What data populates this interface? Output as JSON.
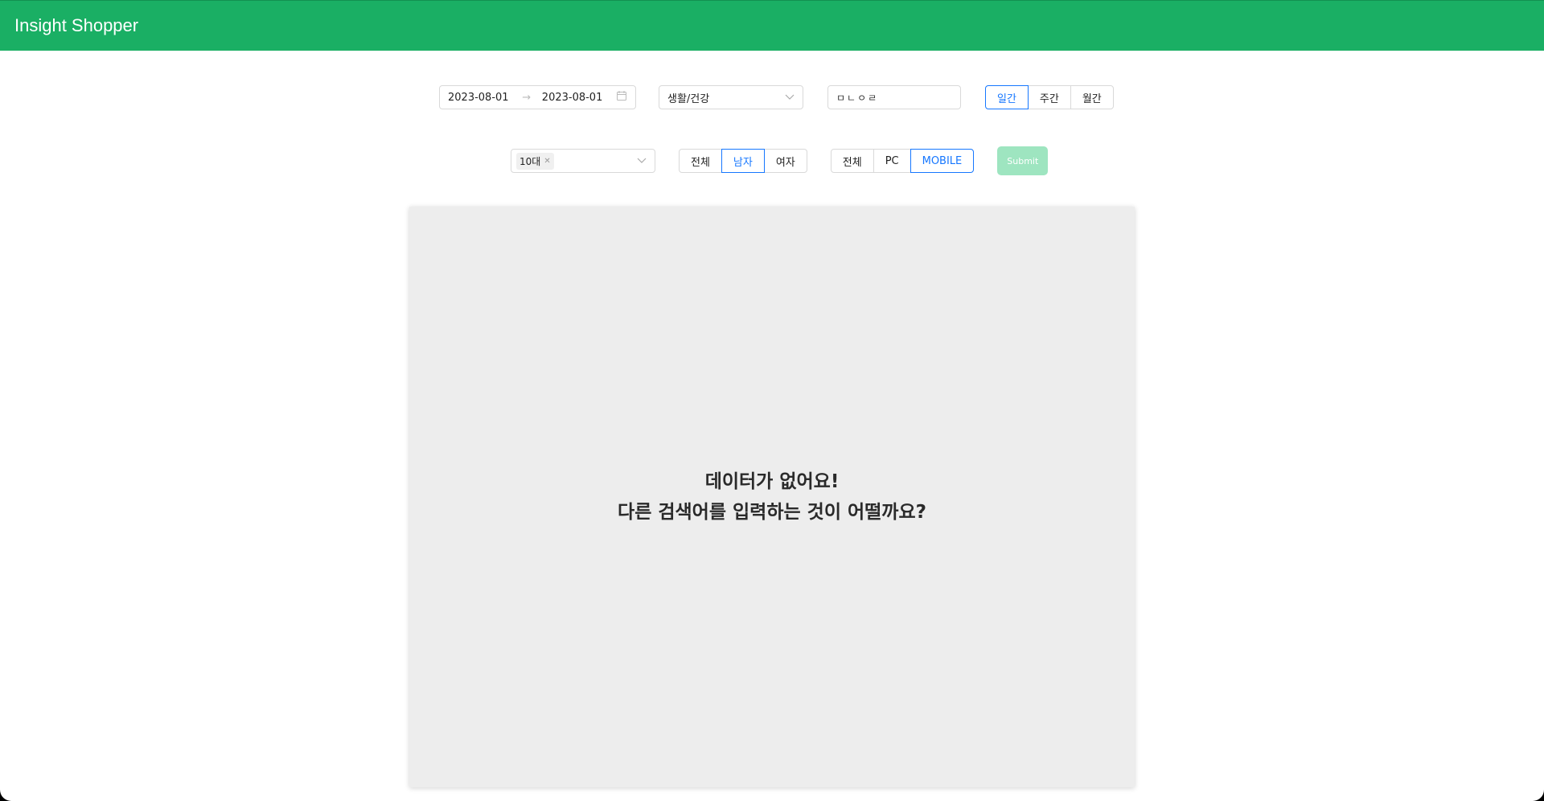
{
  "header": {
    "title": "Insight Shopper"
  },
  "filters": {
    "date_range": {
      "start": "2023-08-01",
      "end": "2023-08-01",
      "separator": "→"
    },
    "category": {
      "selected": "생활/건강"
    },
    "keyword": {
      "value": "ㅁㄴㅇㄹ"
    },
    "period": {
      "options": [
        "일간",
        "주간",
        "월간"
      ],
      "selected": "일간"
    },
    "age": {
      "tags": [
        "10대"
      ]
    },
    "gender": {
      "options": [
        "전체",
        "남자",
        "여자"
      ],
      "selected": "남자"
    },
    "device": {
      "options": [
        "전체",
        "PC",
        "MOBILE"
      ],
      "selected": "MOBILE"
    },
    "submit_label": "Submit"
  },
  "empty_state": {
    "line1": "데이터가 없어요!",
    "line2": "다른 검색어를 입력하는 것이 어떨까요?"
  },
  "colors": {
    "brand": "#1aaf64",
    "active": "#1677ff",
    "submit_disabled": "#9ee5c0"
  }
}
